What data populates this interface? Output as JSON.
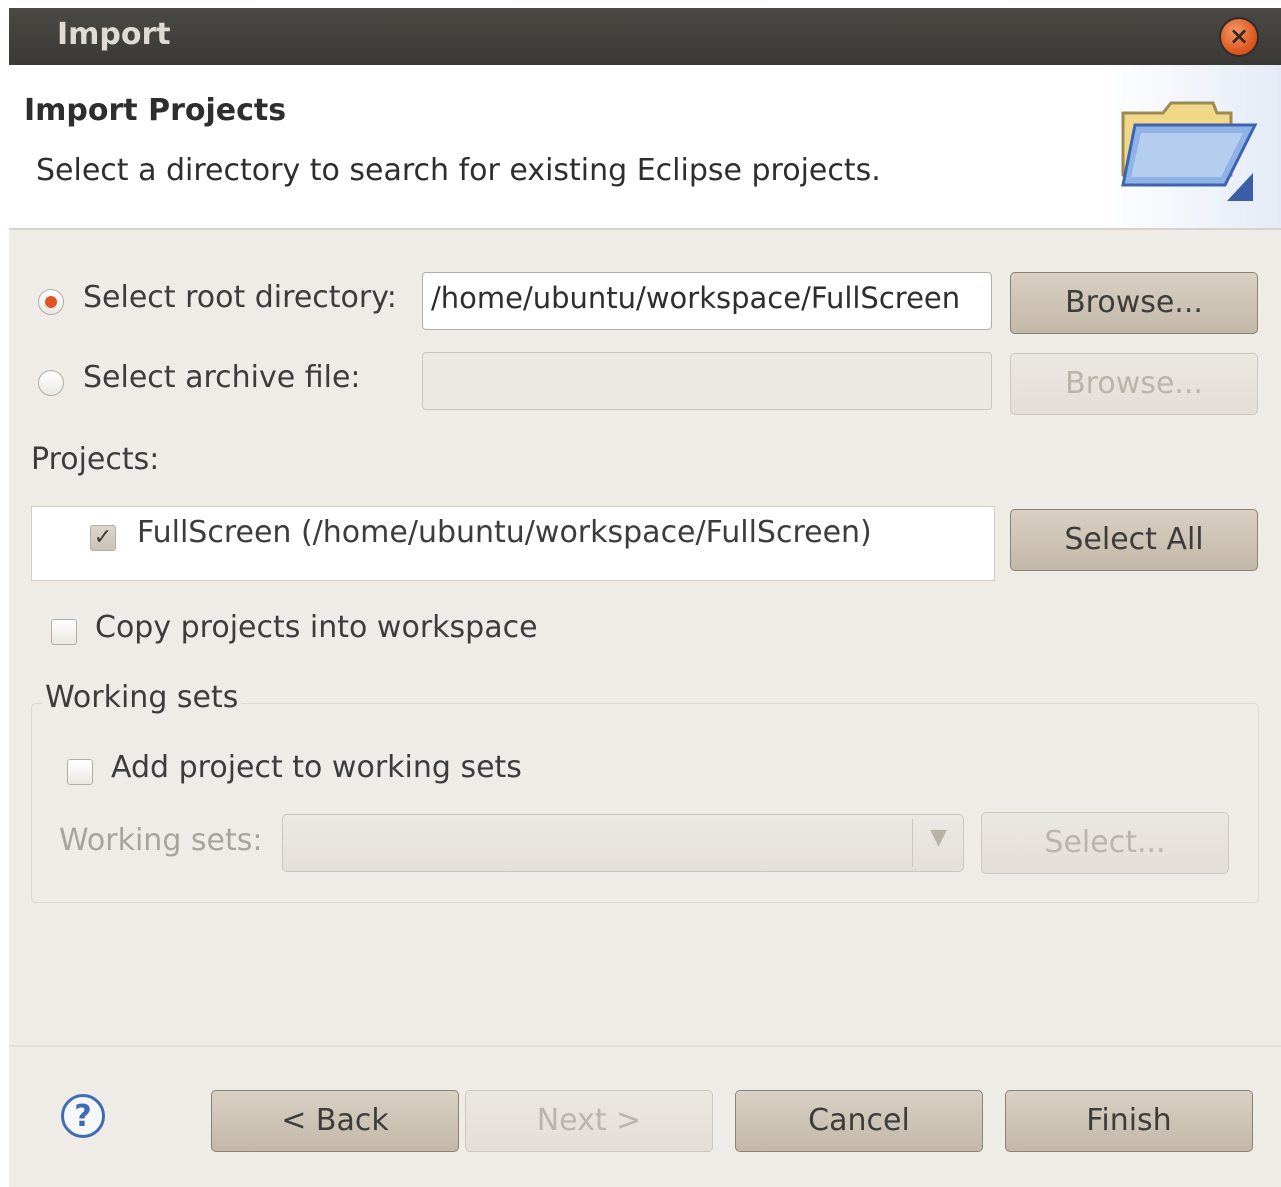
{
  "window": {
    "title": "Import",
    "close_icon": "close-icon"
  },
  "header": {
    "title": "Import Projects",
    "description": "Select a directory to search for existing Eclipse projects.",
    "icon": "folder-open-icon"
  },
  "source": {
    "root_directory": {
      "label": "Select root directory:",
      "selected": true,
      "value": "/home/ubuntu/workspace/FullScreen",
      "browse_label": "Browse..."
    },
    "archive_file": {
      "label": "Select archive file:",
      "selected": false,
      "value": "",
      "browse_label": "Browse..."
    }
  },
  "projects": {
    "label": "Projects:",
    "items": [
      {
        "label": "FullScreen (/home/ubuntu/workspace/FullScreen)",
        "checked": true
      }
    ],
    "select_all_label": "Select All"
  },
  "options": {
    "copy_into_workspace": {
      "label": "Copy projects into workspace",
      "checked": false
    }
  },
  "working_sets": {
    "group_label": "Working sets",
    "add_to_working_sets": {
      "label": "Add project to working sets",
      "checked": false
    },
    "field_label": "Working sets:",
    "value": "",
    "select_label": "Select..."
  },
  "footer": {
    "help_icon": "help-icon",
    "help_glyph": "?",
    "back_label": "< Back",
    "next_label": "Next >",
    "cancel_label": "Cancel",
    "finish_label": "Finish"
  },
  "colors": {
    "dialog_bg": "#efebe7",
    "titlebar_bg": "#3f3e3a",
    "accent_radio": "#e1542a",
    "button_bg": "#c9bfb0"
  }
}
